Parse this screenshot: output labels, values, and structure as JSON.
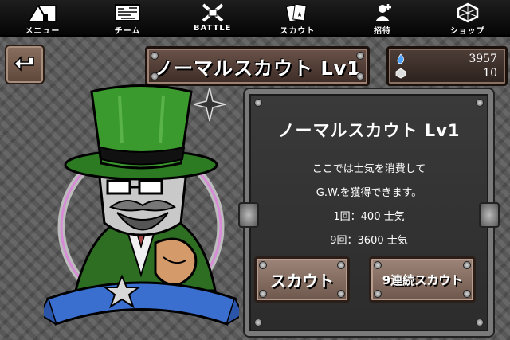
{
  "nav": [
    {
      "label": "メニュー",
      "icon": "tent-menu-icon"
    },
    {
      "label": "チーム",
      "icon": "map-team-icon"
    },
    {
      "label": "BATTLE",
      "icon": "crossed-weapons-icon"
    },
    {
      "label": "スカウト",
      "icon": "cards-scout-icon"
    },
    {
      "label": "招待",
      "icon": "invite-person-icon"
    },
    {
      "label": "ショップ",
      "icon": "gem-shop-icon"
    }
  ],
  "header": {
    "title": "ノーマルスカウト Lv1",
    "back_icon": "back-arrow-icon"
  },
  "resources": {
    "morale": "3957",
    "gw": "10"
  },
  "panel": {
    "title": "ノーマルスカウト Lv1",
    "desc_line1": "ここでは士気を消費して",
    "desc_line2": "G.W.を獲得できます。",
    "cost_single": "1回：400 士気",
    "cost_nine": "9回：3600 士気"
  },
  "buttons": {
    "scout": "スカウト",
    "scout9": "9連続スカウト"
  },
  "colors": {
    "hat_green": "#3b9a2e",
    "panel_bg": "#333333",
    "button_brown": "#8a7165"
  }
}
